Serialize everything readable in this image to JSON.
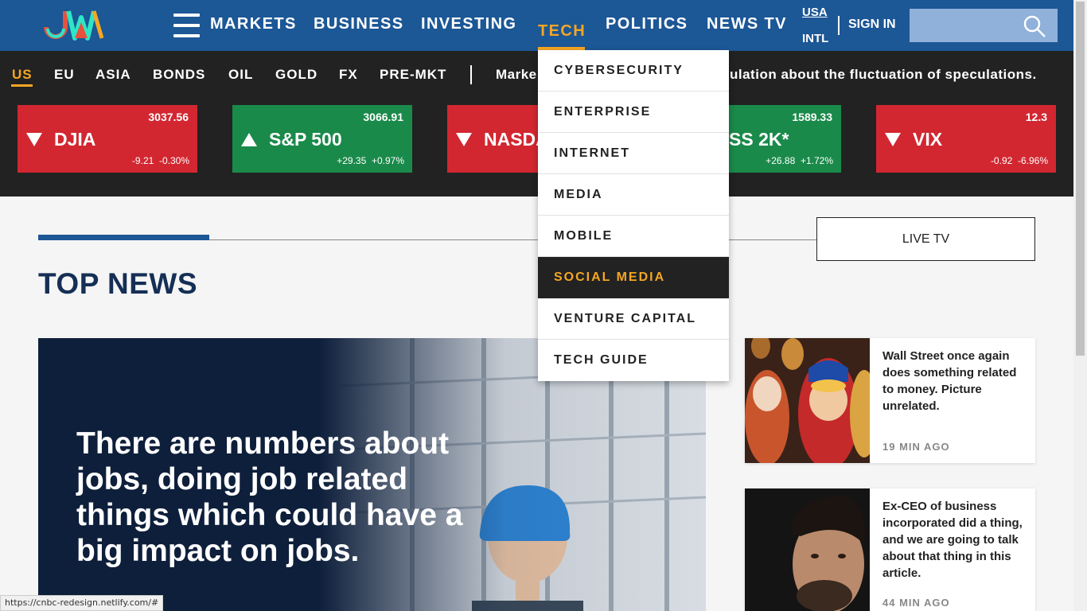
{
  "header": {
    "nav": [
      "MARKETS",
      "BUSINESS",
      "INVESTING",
      "TECH",
      "POLITICS",
      "NEWS TV"
    ],
    "active_nav": "TECH",
    "region_primary": "USA",
    "region_secondary": "INTL",
    "sign_in": "SIGN IN",
    "search_placeholder": "",
    "logo_icon": "jw-logo"
  },
  "market": {
    "tabs": [
      "US",
      "EU",
      "ASIA",
      "BONDS",
      "OIL",
      "GOLD",
      "FX",
      "PRE-MKT"
    ],
    "active_tab": "US",
    "ticker_left": "Marke",
    "ticker_right": "ulation about the fluctuation of speculations.",
    "cards": [
      {
        "name": "DJIA",
        "price": "3037.56",
        "change": "-9.21",
        "pct": "-0.30%",
        "direction": "down"
      },
      {
        "name": "S&P 500",
        "price": "3066.91",
        "change": "+29.35",
        "pct": "+0.97%",
        "direction": "up"
      },
      {
        "name": "NASDA",
        "price": "",
        "change": "",
        "pct": "",
        "direction": "down"
      },
      {
        "name": "SS 2K*",
        "price": "1589.33",
        "change": "+26.88",
        "pct": "+1.72%",
        "direction": "up"
      },
      {
        "name": "VIX",
        "price": "12.3",
        "change": "-0.92",
        "pct": "-6.96%",
        "direction": "down"
      }
    ]
  },
  "dropdown": {
    "items": [
      "CYBERSECURITY",
      "ENTERPRISE",
      "INTERNET",
      "MEDIA",
      "MOBILE",
      "SOCIAL MEDIA",
      "VENTURE CAPITAL",
      "TECH GUIDE"
    ],
    "active_item": "SOCIAL MEDIA"
  },
  "content": {
    "live_tv": "LIVE TV",
    "section_title": "TOP NEWS",
    "hero_title": "There are numbers about jobs, doing job related things which could have a big impact on jobs.",
    "side_stories": [
      {
        "title": "Wall Street once again does something related to money. Picture unrelated.",
        "time": "19 MIN AGO"
      },
      {
        "title": "Ex-CEO of business incorporated did a thing, and we are going to talk about that thing in this article.",
        "time": "44 MIN AGO"
      }
    ]
  },
  "status_bar": "https://cnbc-redesign.netlify.com/#",
  "colors": {
    "header_bg": "#1c5796",
    "accent": "#f5a623",
    "market_bg": "#222222",
    "down": "#d22731",
    "up": "#1a8a4a",
    "title_navy": "#152f55"
  }
}
